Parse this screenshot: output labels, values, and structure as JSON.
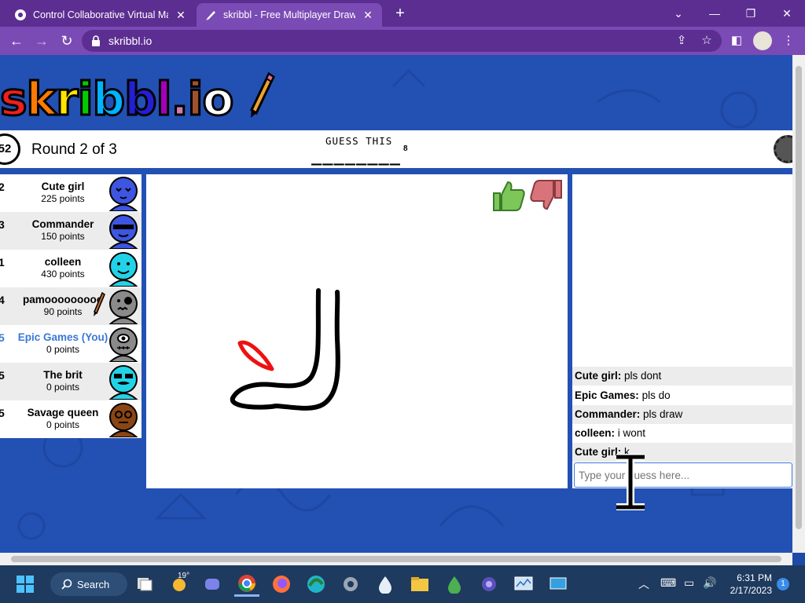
{
  "browser": {
    "tabs": [
      {
        "title": "Control Collaborative Virtual Mac",
        "active": false
      },
      {
        "title": "skribbl - Free Multiplayer Drawing",
        "active": true
      }
    ],
    "url": "skribbl.io"
  },
  "game": {
    "logo": "skribbl.io",
    "timer": "52",
    "round": "Round 2 of 3",
    "guess_title": "GUESS THIS",
    "word_hint": "________",
    "word_length": "8"
  },
  "players": [
    {
      "rank": "2",
      "name": "Cute girl",
      "points": "225 points",
      "color": "#3d55e0"
    },
    {
      "rank": "3",
      "name": "Commander",
      "points": "150 points",
      "color": "#3d55e0"
    },
    {
      "rank": "1",
      "name": "colleen",
      "points": "430 points",
      "color": "#22d3e8"
    },
    {
      "rank": "4",
      "name": "pamooooooooo",
      "points": "90 points",
      "color": "#8a8a8a"
    },
    {
      "rank": "5",
      "name": "Epic Games (You)",
      "points": "0 points",
      "color": "#8a8a8a"
    },
    {
      "rank": "5",
      "name": "The brit",
      "points": "0 points",
      "color": "#22d3e8"
    },
    {
      "rank": "5",
      "name": "Savage queen",
      "points": "0 points",
      "color": "#8b4513"
    }
  ],
  "chat": {
    "messages": [
      {
        "user": "Cute girl:",
        "text": "pls dont"
      },
      {
        "user": "Epic Games:",
        "text": "pls do"
      },
      {
        "user": "Commander:",
        "text": "pls draw"
      },
      {
        "user": "colleen:",
        "text": "i wont"
      },
      {
        "user": "Cute girl:",
        "text": "k"
      }
    ],
    "placeholder": "Type your guess here..."
  },
  "taskbar": {
    "search_label": "Search",
    "weather": "19°",
    "time": "6:31 PM",
    "date": "2/17/2023",
    "notifications": "1"
  }
}
